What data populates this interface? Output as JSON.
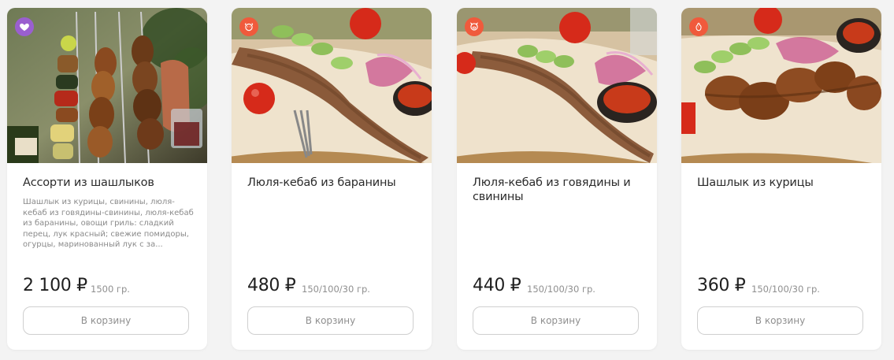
{
  "currency": "₽",
  "colors": {
    "badge_heart": "#9a5fcf",
    "badge_animal": "#f05a3c",
    "button_border": "#cfcfcf",
    "muted_text": "#8f8f8f"
  },
  "products": [
    {
      "badge_icon": "heart-icon",
      "title": "Ассорти из шашлыков",
      "description": "Шашлык из курицы, свинины, люля-кебаб из говядины-свинины, люля-кебаб из баранины, овощи гриль: сладкий перец, лук красный; свежие помидоры, огурцы, маринованный лук с за...",
      "price": "2 100 ₽",
      "weight": "1500 гр.",
      "cart_label": "В корзину"
    },
    {
      "badge_icon": "sheep-icon",
      "title": "Люля-кебаб из баранины",
      "description": "",
      "price": "480 ₽",
      "weight": "150/100/30 гр.",
      "cart_label": "В корзину"
    },
    {
      "badge_icon": "pig-icon",
      "title": "Люля-кебаб из говядины и свинины",
      "description": "",
      "price": "440 ₽",
      "weight": "150/100/30 гр.",
      "cart_label": "В корзину"
    },
    {
      "badge_icon": "chicken-icon",
      "title": "Шашлык из курицы",
      "description": "",
      "price": "360 ₽",
      "weight": "150/100/30 гр.",
      "cart_label": "В корзину"
    }
  ]
}
